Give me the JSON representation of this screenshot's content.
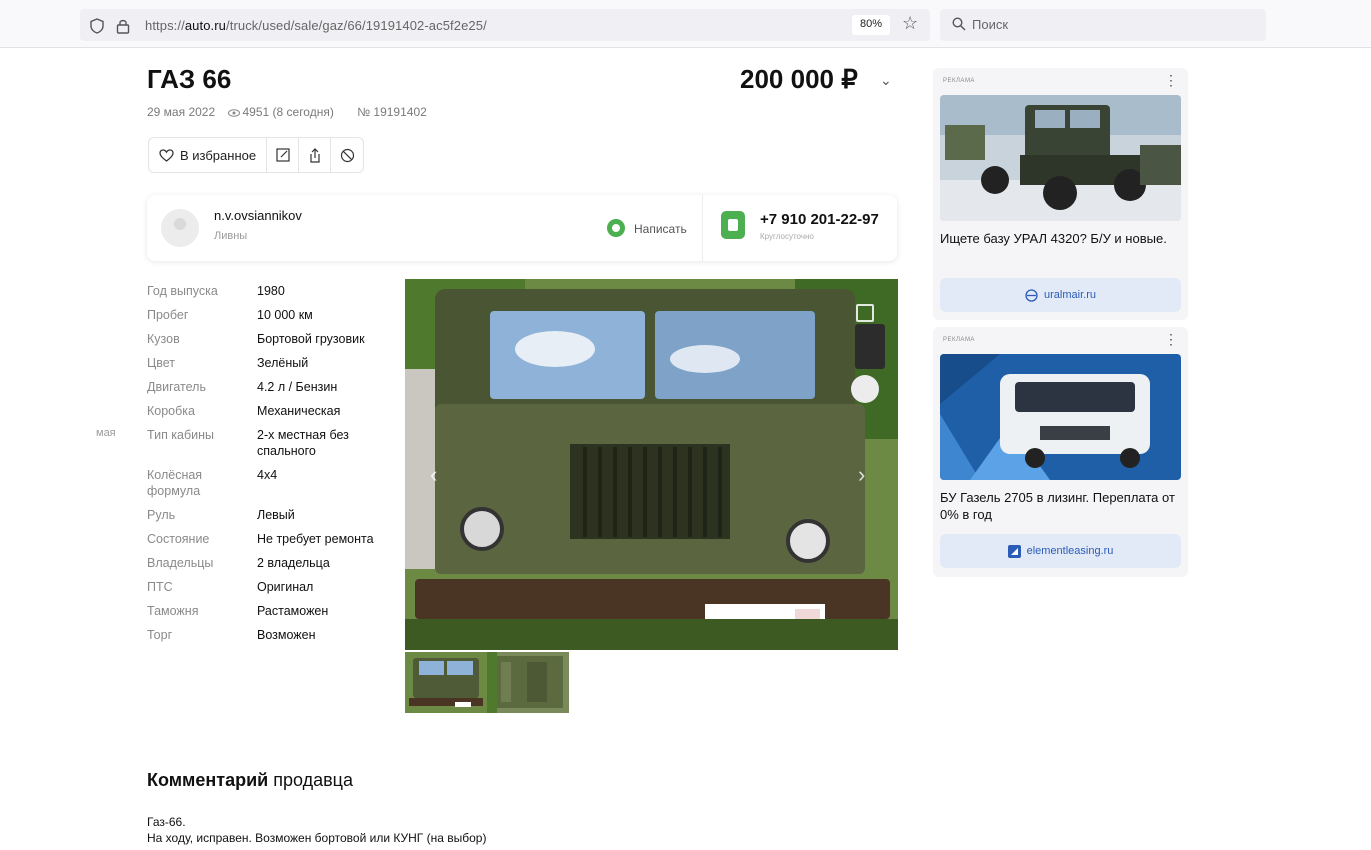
{
  "browser": {
    "url_prefix": "https://",
    "url_domain": "auto.ru",
    "url_path": "/truck/used/sale/gaz/66/19191402-ac5f2e25/",
    "zoom": "80%",
    "search_placeholder": "Поиск"
  },
  "listing": {
    "title": "ГАЗ 66",
    "price": "200 000 ₽",
    "date": "29 мая 2022",
    "views": "4951 (8 сегодня)",
    "number": "№ 19191402",
    "favorite_label": "В избранное"
  },
  "seller": {
    "name": "n.v.ovsiannikov",
    "city": "Ливны",
    "write_label": "Написать",
    "phone": "+7 910 201-22-97",
    "phone_note": "Круглосуточно"
  },
  "side_note": "мая",
  "specs": [
    {
      "label": "Год выпуска",
      "value": "1980"
    },
    {
      "label": "Пробег",
      "value": "10 000 км"
    },
    {
      "label": "Кузов",
      "value": "Бортовой грузовик"
    },
    {
      "label": "Цвет",
      "value": "Зелёный"
    },
    {
      "label": "Двигатель",
      "value": "4.2 л / Бензин"
    },
    {
      "label": "Коробка",
      "value": "Механическая"
    },
    {
      "label": "Тип кабины",
      "value": "2-х местная без спального"
    },
    {
      "label": "Колёсная формула",
      "value": "4x4"
    },
    {
      "label": "Руль",
      "value": "Левый"
    },
    {
      "label": "Состояние",
      "value": "Не требует ремонта"
    },
    {
      "label": "Владельцы",
      "value": "2 владельца"
    },
    {
      "label": "ПТС",
      "value": "Оригинал"
    },
    {
      "label": "Таможня",
      "value": "Растаможен"
    },
    {
      "label": "Торг",
      "value": "Возможен"
    }
  ],
  "comment": {
    "title_bold": "Комментарий",
    "title_rest": "продавца",
    "line1": "Газ-66.",
    "line2": "На ходу, исправен. Возможен бортовой или КУНГ (на выбор)"
  },
  "ads": [
    {
      "label": "РЕКЛАМА",
      "text": "Ищете базу УРАЛ 4320? Б/У и новые.",
      "domain": "uralmair.ru"
    },
    {
      "label": "РЕКЛАМА",
      "text": "БУ Газель 2705 в лизинг. Переплата от 0% в год",
      "domain": "elementleasing.ru"
    }
  ],
  "colors": {
    "accent_green": "#4cb050",
    "ad_button_bg": "#e3eaf7",
    "link_blue": "#2a5cb8"
  }
}
